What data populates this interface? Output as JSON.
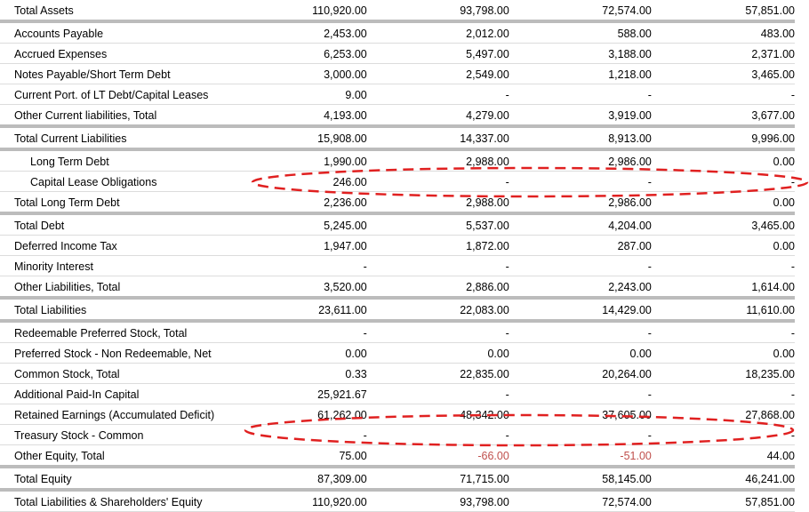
{
  "balance_sheet": {
    "rows": [
      {
        "label": "Total Assets",
        "values": [
          "110,920.00",
          "93,798.00",
          "72,574.00",
          "57,851.00"
        ]
      },
      {
        "label": "Accounts Payable",
        "values": [
          "2,453.00",
          "2,012.00",
          "588.00",
          "483.00"
        ]
      },
      {
        "label": "Accrued Expenses",
        "values": [
          "6,253.00",
          "5,497.00",
          "3,188.00",
          "2,371.00"
        ]
      },
      {
        "label": "Notes Payable/Short Term Debt",
        "values": [
          "3,000.00",
          "2,549.00",
          "1,218.00",
          "3,465.00"
        ]
      },
      {
        "label": "Current Port. of LT Debt/Capital Leases",
        "values": [
          "9.00",
          "-",
          "-",
          "-"
        ]
      },
      {
        "label": "Other Current liabilities, Total",
        "values": [
          "4,193.00",
          "4,279.00",
          "3,919.00",
          "3,677.00"
        ]
      },
      {
        "label": "Total Current Liabilities",
        "values": [
          "15,908.00",
          "14,337.00",
          "8,913.00",
          "9,996.00"
        ]
      },
      {
        "label": "Long Term Debt",
        "values": [
          "1,990.00",
          "2,988.00",
          "2,986.00",
          "0.00"
        ]
      },
      {
        "label": "Capital Lease Obligations",
        "values": [
          "246.00",
          "-",
          "-",
          "-"
        ]
      },
      {
        "label": "Total Long Term Debt",
        "values": [
          "2,236.00",
          "2,988.00",
          "2,986.00",
          "0.00"
        ]
      },
      {
        "label": "Total Debt",
        "values": [
          "5,245.00",
          "5,537.00",
          "4,204.00",
          "3,465.00"
        ]
      },
      {
        "label": "Deferred Income Tax",
        "values": [
          "1,947.00",
          "1,872.00",
          "287.00",
          "0.00"
        ]
      },
      {
        "label": "Minority Interest",
        "values": [
          "-",
          "-",
          "-",
          "-"
        ]
      },
      {
        "label": "Other Liabilities, Total",
        "values": [
          "3,520.00",
          "2,886.00",
          "2,243.00",
          "1,614.00"
        ]
      },
      {
        "label": "Total Liabilities",
        "values": [
          "23,611.00",
          "22,083.00",
          "14,429.00",
          "11,610.00"
        ]
      },
      {
        "label": "Redeemable Preferred Stock, Total",
        "values": [
          "-",
          "-",
          "-",
          "-"
        ]
      },
      {
        "label": "Preferred Stock - Non Redeemable, Net",
        "values": [
          "0.00",
          "0.00",
          "0.00",
          "0.00"
        ]
      },
      {
        "label": "Common Stock, Total",
        "values": [
          "0.33",
          "22,835.00",
          "20,264.00",
          "18,235.00"
        ]
      },
      {
        "label": "Additional Paid-In Capital",
        "values": [
          "25,921.67",
          "-",
          "-",
          "-"
        ]
      },
      {
        "label": "Retained Earnings (Accumulated Deficit)",
        "values": [
          "61,262.00",
          "48,342.00",
          "37,605.00",
          "27,868.00"
        ]
      },
      {
        "label": "Treasury Stock - Common",
        "values": [
          "-",
          "-",
          "-",
          "-"
        ]
      },
      {
        "label": "Other Equity, Total",
        "values": [
          "75.00",
          "-66.00",
          "-51.00",
          "44.00"
        ]
      },
      {
        "label": "Total Equity",
        "values": [
          "87,309.00",
          "71,715.00",
          "58,145.00",
          "46,241.00"
        ]
      },
      {
        "label": "Total Liabilities & Shareholders' Equity",
        "values": [
          "110,920.00",
          "93,798.00",
          "72,574.00",
          "57,851.00"
        ]
      }
    ]
  },
  "annotations": {
    "color": "#e02020",
    "highlighted_rows": [
      "Total Long Term Debt",
      "Total Equity"
    ]
  },
  "colors": {
    "text": "#000000",
    "negative": "#c0504d",
    "row_rule": "#dcdcdc",
    "section_rule": "#bcbcbc"
  }
}
